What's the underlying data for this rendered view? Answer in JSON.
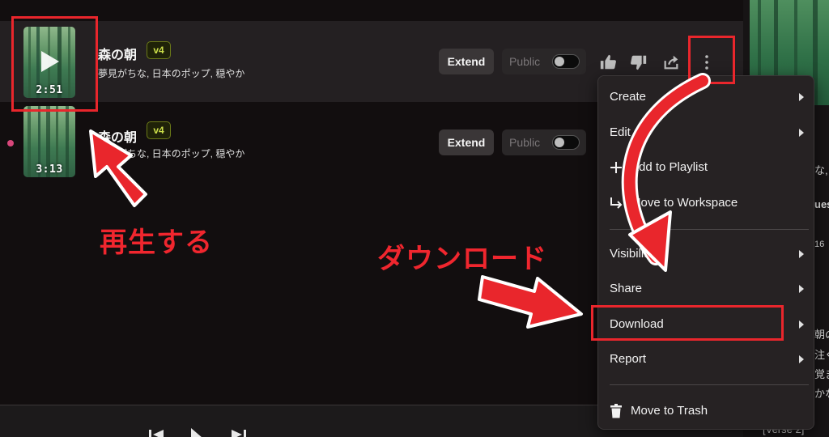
{
  "songs": [
    {
      "title": "森の朝",
      "version": "v4",
      "tags": "夢見がちな, 日本のポップ, 穏やか",
      "duration": "2:51",
      "extend_label": "Extend",
      "public_label": "Public"
    },
    {
      "title": "森の朝",
      "version": "v4",
      "tags": "夢見がちな, 日本のポップ, 穏やか",
      "duration": "3:13",
      "extend_label": "Extend",
      "public_label": "Public"
    }
  ],
  "menu": {
    "items": [
      {
        "label": "Create",
        "has_submenu": true
      },
      {
        "label": "Edit",
        "has_submenu": true
      },
      {
        "label": "Add to Playlist",
        "icon": "plus-icon"
      },
      {
        "label": "Move to Workspace",
        "icon": "move-arrow-icon"
      },
      {
        "label": "Visibility",
        "has_submenu": true
      },
      {
        "label": "Share",
        "has_submenu": true
      },
      {
        "label": "Download",
        "has_submenu": true
      },
      {
        "label": "Report",
        "has_submenu": true
      },
      {
        "label": "Move to Trash",
        "icon": "trash-icon"
      }
    ]
  },
  "right_panel": {
    "fragments": [
      "な,",
      "ues",
      "16",
      "朝の",
      "注ぐ",
      "覚ま",
      "かな",
      "[Verse 2]"
    ]
  },
  "annotations": {
    "play": "再生する",
    "download": "ダウンロード",
    "color": "#e9262c"
  },
  "icons": [
    "play-icon",
    "thumbs-up-icon",
    "thumbs-down-icon",
    "share-icon",
    "more-vertical-icon",
    "plus-icon",
    "move-arrow-icon",
    "trash-icon",
    "chevron-right-icon"
  ]
}
